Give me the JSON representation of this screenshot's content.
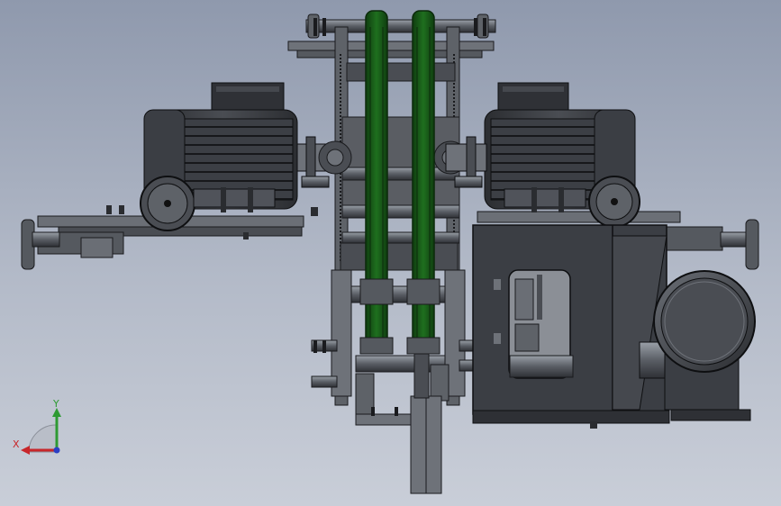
{
  "viewport": {
    "background_top": "#8f99ad",
    "background_bottom": "#c9ced8"
  },
  "colors": {
    "belt_green": "#1e6b1e",
    "belt_dark": "#0f3d0f",
    "steel_dark": "#3a3d42",
    "steel_mid": "#5e6268",
    "steel_light": "#8b8f96",
    "steel_edge": "#1a1b1e",
    "axis_x": "#c8262a",
    "axis_y": "#2e9a33",
    "axis_z": "#2b3fc4"
  },
  "triad": {
    "x_label": "X",
    "y_label": "Y"
  },
  "parts": {
    "left_motor": "motor",
    "right_motor": "motor",
    "left_belt": "conveyor-belt",
    "right_belt": "conveyor-belt",
    "gearbox": "gearbox-housing",
    "blower": "blower-fan"
  }
}
